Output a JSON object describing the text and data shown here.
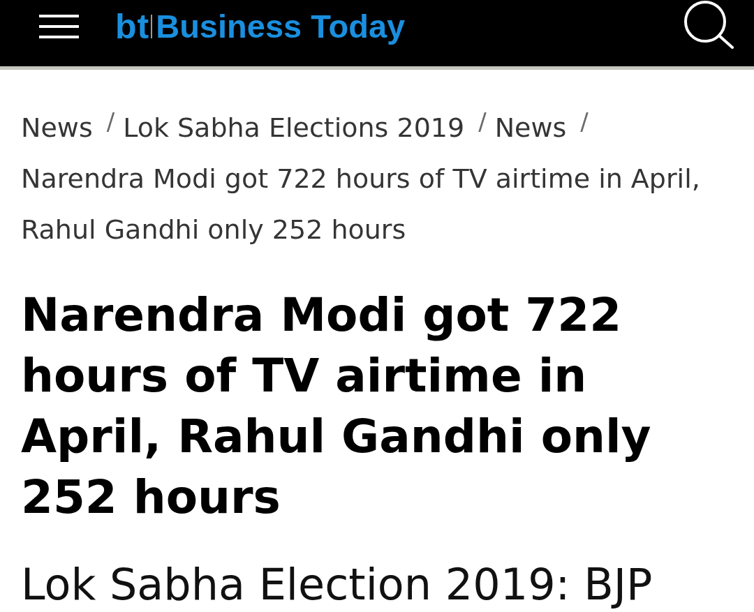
{
  "header": {
    "logo": {
      "mark": "bt",
      "name": "Business Today"
    }
  },
  "breadcrumb": [
    {
      "label": "News",
      "separator": "/"
    },
    {
      "label": "Lok Sabha Elections 2019",
      "separator": "/"
    },
    {
      "label": "News",
      "separator": "/"
    },
    {
      "label": "Narendra Modi got 722 hours of TV airtime in April, Rahul Gandhi only 252 hours"
    }
  ],
  "article": {
    "headline": "Narendra Modi got 722 hours of TV airtime in April, Rahul Gandhi only 252 hours",
    "subheading": "Lok Sabha Election 2019: BJP"
  }
}
